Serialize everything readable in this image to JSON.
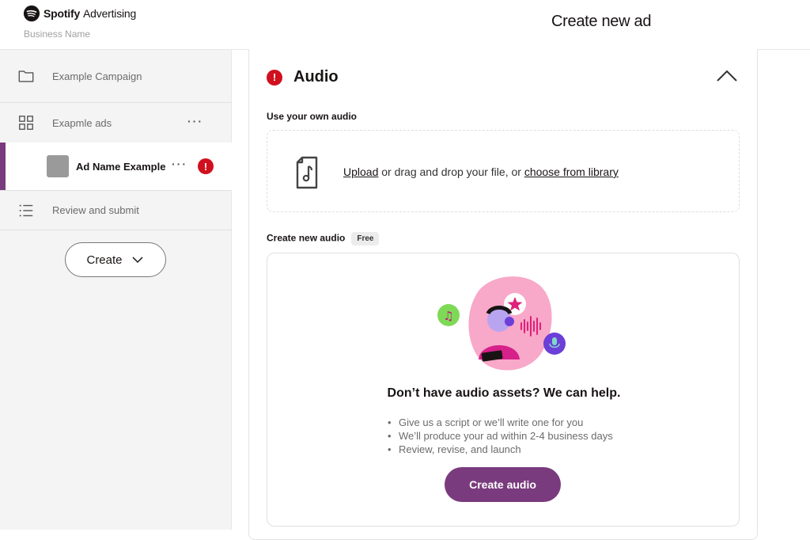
{
  "header": {
    "brand_name": "Spotify",
    "brand_product": "Advertising",
    "business_name": "Business Name",
    "page_title": "Create new ad"
  },
  "sidebar": {
    "campaign_label": "Example Campaign",
    "ads_label": "Exapmle ads",
    "ad_name_label": "Ad Name Example",
    "review_label": "Review and submit",
    "more_glyph": "···",
    "error_glyph": "!",
    "create_button_label": "Create"
  },
  "main": {
    "section_title": "Audio",
    "use_own_label": "Use your own audio",
    "upload_link": "Upload",
    "upload_middle": " or drag and drop your file, or ",
    "library_link": "choose from library",
    "create_new_label": "Create new audio",
    "free_badge": "Free",
    "help_title": "Don’t have audio assets? We can help.",
    "help_items": [
      "Give us a script or we’ll write one for you",
      "We’ll produce your ad within 2-4 business days",
      "Review, revise, and launch"
    ],
    "create_audio_button": "Create audio"
  },
  "colors": {
    "accent": "#7a3b7e",
    "error": "#d0101e",
    "sidebar_bg": "#f4f4f4"
  }
}
